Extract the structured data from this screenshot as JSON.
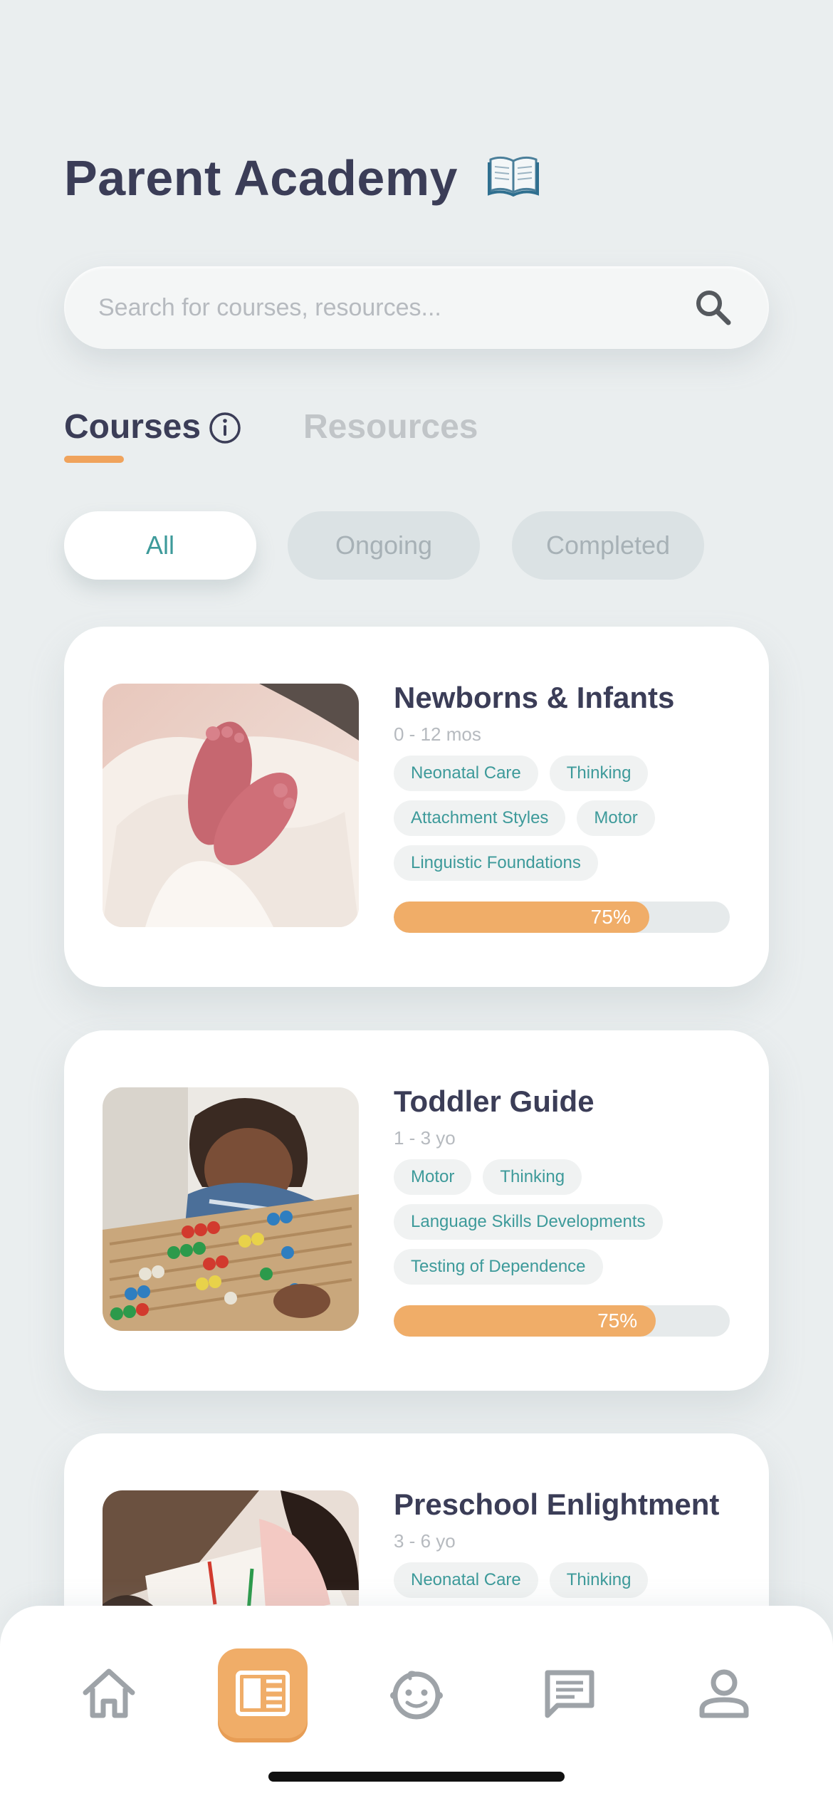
{
  "header": {
    "title": "Parent Academy",
    "title_emoji": "open-book-emoji"
  },
  "search": {
    "placeholder": "Search for courses, resources...",
    "value": "",
    "icon": "search-icon"
  },
  "tabs": [
    {
      "label": "Courses",
      "active": true,
      "icon": "info-icon"
    },
    {
      "label": "Resources",
      "active": false
    }
  ],
  "filters": [
    {
      "label": "All",
      "selected": true
    },
    {
      "label": "Ongoing",
      "selected": false
    },
    {
      "label": "Completed",
      "selected": false
    }
  ],
  "courses": [
    {
      "title": "Newborns & Infants",
      "age": "0 - 12 mos",
      "tags": [
        [
          "Neonatal Care",
          "Thinking"
        ],
        [
          "Attachment Styles",
          "Motor"
        ],
        [
          "Linguistic Foundations"
        ]
      ],
      "progress": 0.76,
      "progress_label": "75%",
      "image": "newborn-feet-photo"
    },
    {
      "title": "Toddler Guide",
      "age": "1 - 3 yo",
      "tags": [
        [
          "Motor",
          "Thinking"
        ],
        [
          "Language Skills Developments"
        ],
        [
          "Testing of Dependence"
        ]
      ],
      "progress": 0.78,
      "progress_label": "75%",
      "image": "toddler-abacus-photo"
    },
    {
      "title": "Preschool Enlightment",
      "age": "3 - 6 yo",
      "tags": [
        [
          "Neonatal Care",
          "Thinking"
        ]
      ],
      "image": "preschool-drawing-photo"
    }
  ],
  "colors": {
    "accent": "#f0ad68",
    "teal": "#3d9a9a",
    "title": "#3b3d57",
    "background": "#eaeeef"
  },
  "bottom_nav": [
    {
      "icon": "home-icon",
      "active": false
    },
    {
      "icon": "courses-icon",
      "active": true
    },
    {
      "icon": "child-face-icon",
      "active": false
    },
    {
      "icon": "chat-icon",
      "active": false
    },
    {
      "icon": "profile-icon",
      "active": false
    }
  ]
}
